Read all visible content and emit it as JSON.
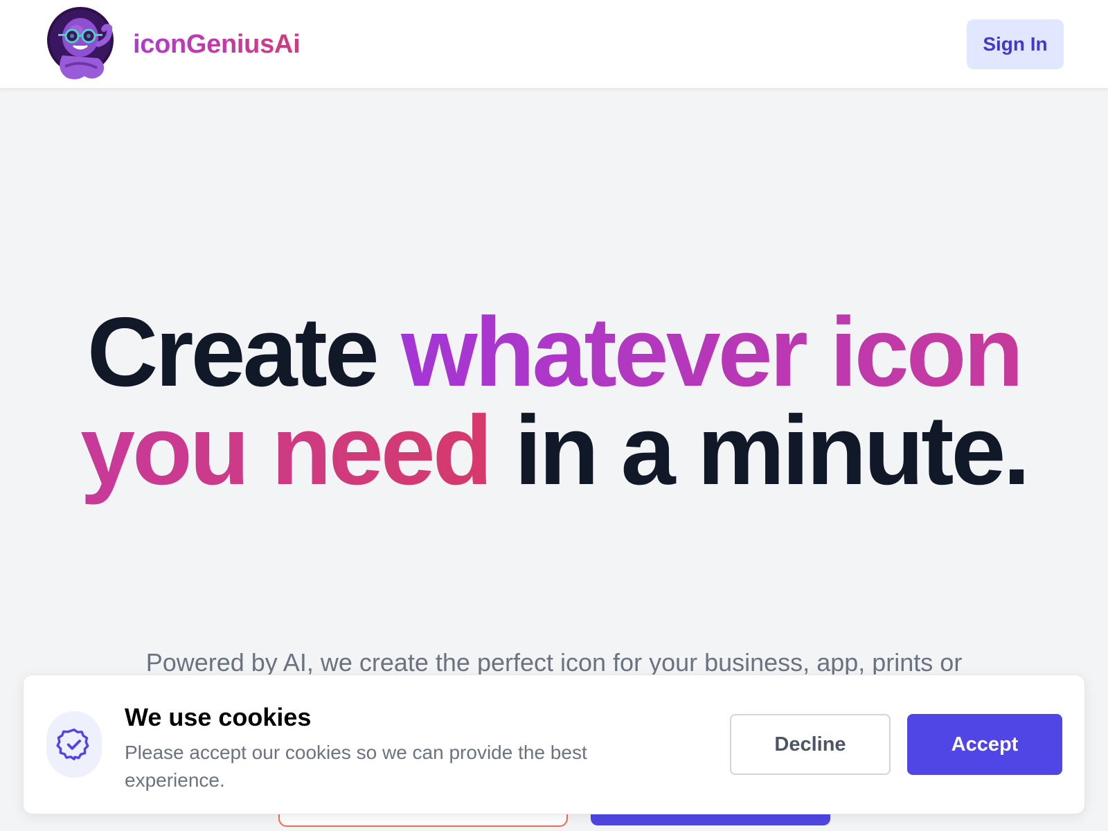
{
  "header": {
    "brand_name": "iconGeniusAi",
    "logo_icon": "octopus-mascot-with-glasses",
    "sign_in_label": "Sign In"
  },
  "hero": {
    "title_part1": "Create ",
    "title_highlight": "whatever icon you need",
    "title_part2": " in a minute.",
    "subtitle": "Powered by AI, we create the perfect icon for your business, app, prints or"
  },
  "cookie_banner": {
    "icon": "verified-badge-icon",
    "title": "We use cookies",
    "text": "Please accept our cookies so we can provide the best experience.",
    "decline_label": "Decline",
    "accept_label": "Accept"
  },
  "colors": {
    "brand_gradient_start": "#a436d6",
    "brand_gradient_end": "#d63a6a",
    "primary": "#4f46e5",
    "primary_light": "#e0e7ff",
    "background": "#f3f4f6"
  }
}
